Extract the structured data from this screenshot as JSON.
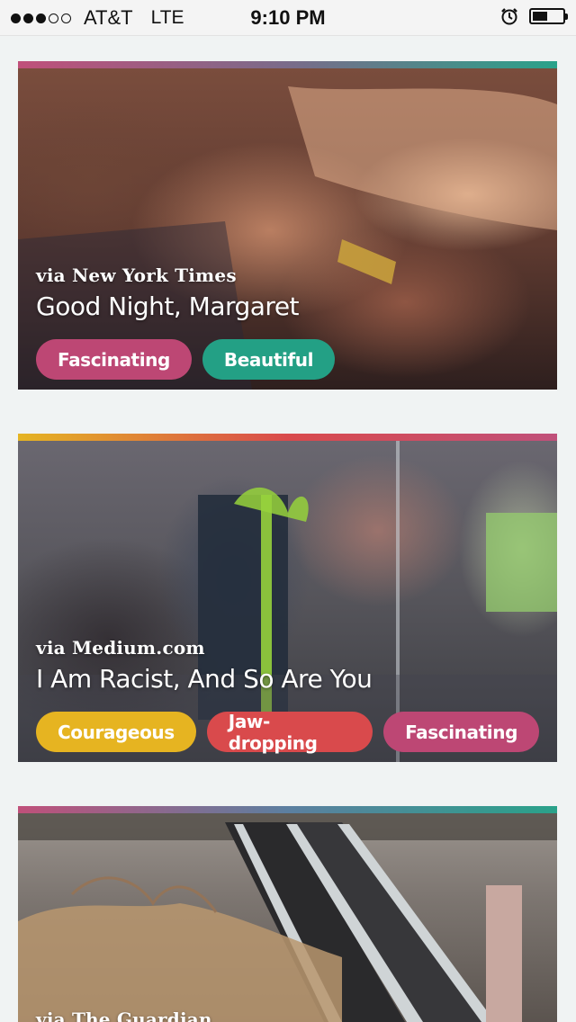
{
  "status_bar": {
    "signal_dots": [
      "on",
      "on",
      "on",
      "off",
      "off"
    ],
    "carrier": "AT&T",
    "network": "LTE",
    "time": "9:10 PM",
    "alarm_icon": "alarm-icon",
    "battery_level": 0.45
  },
  "feed": [
    {
      "source": "via New York Times",
      "title": "Good Night, Margaret",
      "tags": [
        {
          "label": "Fascinating",
          "color": "#bd4774"
        },
        {
          "label": "Beautiful",
          "color": "#23a085"
        }
      ]
    },
    {
      "source": "via Medium.com",
      "title": "I Am Racist, And So Are You",
      "tags": [
        {
          "label": "Courageous",
          "color": "#e6b421"
        },
        {
          "label": "Jaw-dropping",
          "color": "#d94a4c"
        },
        {
          "label": "Fascinating",
          "color": "#bd4774"
        }
      ]
    },
    {
      "source": "via The Guardian",
      "title": "",
      "tags": []
    }
  ]
}
